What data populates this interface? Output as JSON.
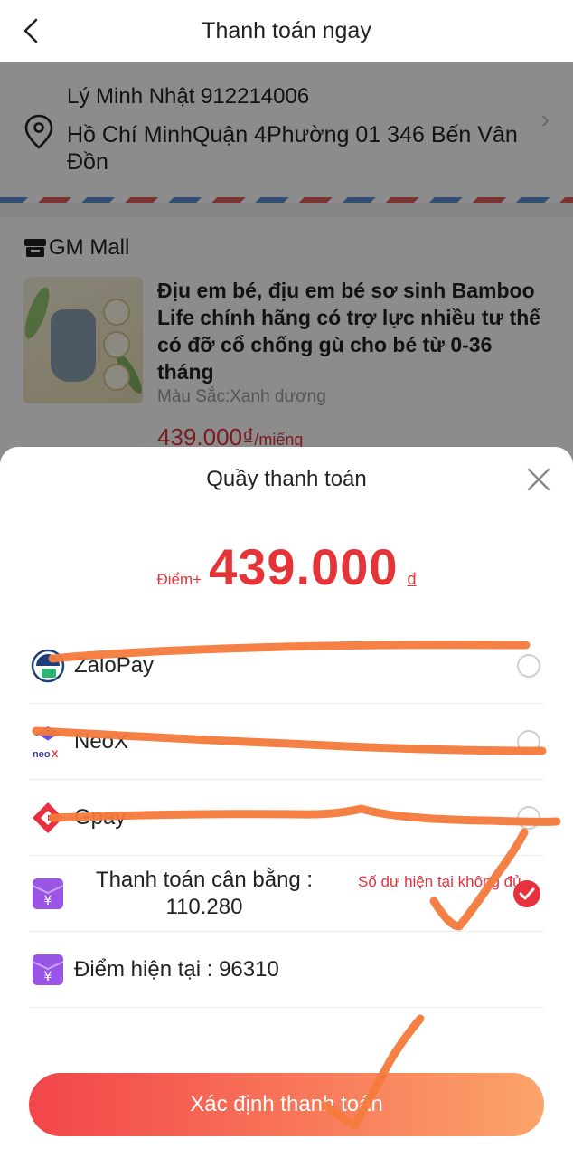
{
  "header": {
    "title": "Thanh toán ngay"
  },
  "address": {
    "name_phone": "Lý Minh Nhật 912214006",
    "line": "Hồ Chí MinhQuận 4Phường 01 346 Bến Vân Đồn"
  },
  "shop": {
    "name": "GM Mall"
  },
  "product": {
    "title": "Địu em bé, địu em bé sơ sinh Bamboo Life chính hãng có trợ lực nhiều tư thế có đỡ cổ chống gù cho bé từ 0-36 tháng",
    "variant": "Màu Sắc:Xanh dương",
    "price": "439.000₫",
    "unit": "/miếng"
  },
  "sheet": {
    "title": "Quầy thanh toán",
    "amount_prefix": "Điểm+",
    "amount": "439.000",
    "currency": "đ"
  },
  "methods": [
    {
      "label": "ZaloPay",
      "selected": false
    },
    {
      "label": "NeoX",
      "selected": false
    },
    {
      "label": "Gpay",
      "selected": false
    },
    {
      "label": "Thanh toán cân bằng : 110.280",
      "selected": true,
      "warning": "Số dư hiện tại không đủ"
    },
    {
      "label": "Điểm hiện tại : 96310"
    }
  ],
  "confirm_label": "Xác định thanh toán",
  "colors": {
    "accent": "#e5323e",
    "scribble": "#f47a3c",
    "wallet": "#8f4fe0"
  }
}
